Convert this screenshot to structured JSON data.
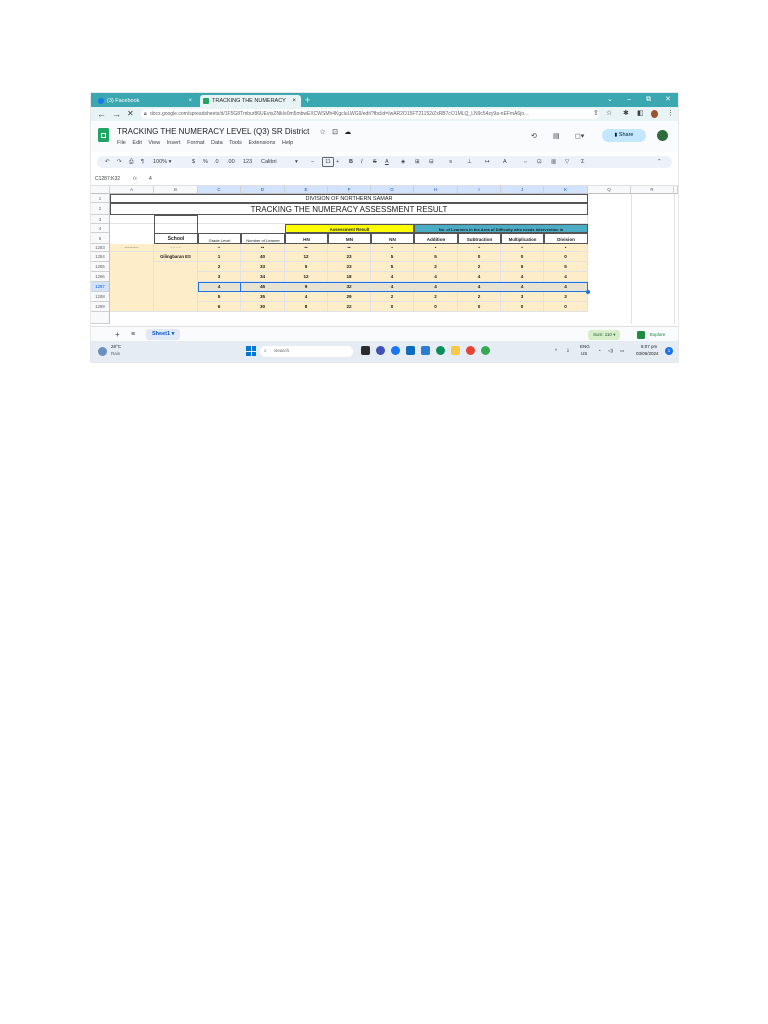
{
  "browser": {
    "tabs": [
      {
        "label": "(3) Facebook",
        "close": "×",
        "active": false
      },
      {
        "label": "TRACKING THE NUMERACY LEV…",
        "close": "×",
        "active": true
      }
    ],
    "new_tab": "+",
    "window_controls": {
      "dropdown": "⌄",
      "minimize": "–",
      "restore": "⧉",
      "close": "✕"
    },
    "nav": {
      "back": "←",
      "forward": "→",
      "reload": "✕"
    },
    "url": "docs.google.com/spreadsheets/d/1F5G8Tmbur86UEvtsZNkIe0m5mbwEXCWSMh4KgcluLWG9/edit?fbclid=IwAR2O15FT21152iZxRB7cO1MLQ_LN9c54zy9a-nEFmA6jo…",
    "url_icons": {
      "share": "⇪",
      "star": "☆",
      "ext": "✱",
      "sidebar": "◧",
      "menu": "⋮"
    }
  },
  "doc": {
    "title": "TRACKING THE NUMERACY LEVEL (Q3) SR District",
    "title_icons": {
      "star": "☆",
      "move": "⊡",
      "cloud": "☁"
    },
    "menus": [
      "File",
      "Edit",
      "View",
      "Insert",
      "Format",
      "Data",
      "Tools",
      "Extensions",
      "Help"
    ],
    "share_label": "Share",
    "share_icon": "lock-icon",
    "header_icons": {
      "history": "⟲",
      "comments": "▤",
      "meet": "◻▾"
    }
  },
  "toolbar": {
    "undo": "↶",
    "redo": "↷",
    "print": "⎙",
    "paint": "¶",
    "zoom": "100%",
    "zoom_caret": "▾",
    "currency": "$",
    "percent": "%",
    "dec_less": ".0",
    "dec_more": ".00",
    "format123": "123",
    "font": "Calibri",
    "font_caret": "▾",
    "minus": "−",
    "font_size": "11",
    "plus": "+",
    "bold": "B",
    "italic": "I",
    "strike": "S",
    "text_color": "A",
    "fill": "◈",
    "borders": "⊞",
    "merge": "⊟",
    "align": "≡",
    "valign": "⊥",
    "wrap": "↦",
    "rotate": "A",
    "link": "⇔",
    "comment": "⊡",
    "chart": "▥",
    "filter": "▽",
    "functions": "Σ",
    "collapse": "⌃"
  },
  "formula_bar": {
    "range": "C1287:K32",
    "fx": "fx",
    "value": "4"
  },
  "grid": {
    "columns": [
      "",
      "A",
      "B",
      "C",
      "D",
      "E",
      "F",
      "G",
      "H",
      "I",
      "J",
      "K",
      "",
      "Q",
      "R"
    ],
    "row_headers": [
      "1",
      "2",
      "3",
      "4",
      "5",
      "1283",
      "1284",
      "1285",
      "1286",
      "1287",
      "1288",
      "1289"
    ],
    "division": "DIVISION OF NORTHERN SAMAR",
    "title": "TRACKING THE NUMERACY ASSESSMENT RESULT",
    "assessment_header": "Assessment Result",
    "learners_header": "No. of Learners in the Area of Difficulty who needs intervention in",
    "col_labels": {
      "school": "School",
      "grade": "Grade Level",
      "learners": "Number of Learner",
      "hn": "HN",
      "mn": "MN",
      "nn": "NN",
      "addition": "Addition",
      "subtraction": "Subtraction",
      "multiplication": "Multiplication",
      "division": "Division"
    },
    "partial_row": {
      "a": "---------",
      "b": "- - - -",
      "c": "•",
      "d": "••",
      "e": "••",
      "f": "••",
      "g": "•",
      "h": "•",
      "i": "•",
      "j": "•",
      "k": "•"
    },
    "school_name": "Gilingbaran ES",
    "rows": [
      {
        "grade": "1",
        "learners": "40",
        "hn": "12",
        "mn": "23",
        "nn": "5",
        "addition": "5",
        "subtraction": "0",
        "multiplication": "0",
        "division": "0"
      },
      {
        "grade": "2",
        "learners": "33",
        "hn": "5",
        "mn": "23",
        "nn": "5",
        "addition": "2",
        "subtraction": "2",
        "multiplication": "5",
        "division": "5"
      },
      {
        "grade": "3",
        "learners": "34",
        "hn": "12",
        "mn": "18",
        "nn": "4",
        "addition": "4",
        "subtraction": "4",
        "multiplication": "4",
        "division": "4"
      },
      {
        "grade": "4",
        "learners": "45",
        "hn": "9",
        "mn": "32",
        "nn": "4",
        "addition": "4",
        "subtraction": "4",
        "multiplication": "4",
        "division": "4"
      },
      {
        "grade": "5",
        "learners": "35",
        "hn": "4",
        "mn": "29",
        "nn": "2",
        "addition": "2",
        "subtraction": "2",
        "multiplication": "3",
        "division": "3"
      },
      {
        "grade": "6",
        "learners": "30",
        "hn": "8",
        "mn": "22",
        "nn": "0",
        "addition": "0",
        "subtraction": "0",
        "multiplication": "0",
        "division": "0"
      }
    ]
  },
  "sheets": {
    "add": "+",
    "list": "≡",
    "active": "Sheet1",
    "caret": "▾",
    "sum": "Sum: 110",
    "sum_caret": "▾",
    "explore": "Explore"
  },
  "taskbar": {
    "weather_temp": "28°C",
    "weather_desc": "Rain",
    "search_placeholder": "Search",
    "lang": "ENG",
    "region": "US",
    "time": "8:07 pm",
    "date": "03/06/2024",
    "notif": "1",
    "tray_icons": {
      "caret": "^",
      "onedrive": "⇩",
      "wifi": "◔",
      "volume": "◁)",
      "battery": "▭"
    }
  },
  "colors": {
    "teal": "#3aa7b1",
    "yellow": "#ffff00",
    "cyan_header": "#4bacc6",
    "cream": "#fdedc8",
    "sheets_green": "#1fa463",
    "share_blue": "#c2e7ff"
  }
}
